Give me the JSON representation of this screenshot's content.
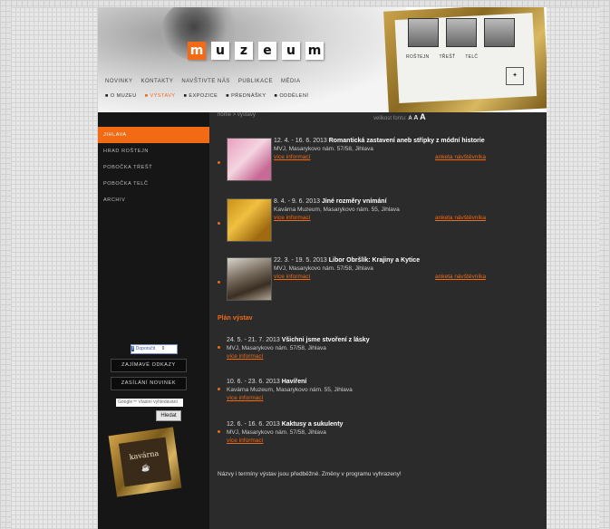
{
  "header": {
    "logo_letters": [
      "m",
      "u",
      "z",
      "e",
      "u",
      "m"
    ],
    "top_nav": [
      "NOVINKY",
      "KONTAKTY",
      "NAVŠTIVTE NÁS",
      "PUBLIKACE",
      "MÉDIA"
    ],
    "sub_nav": [
      "O MUZEU",
      "VÝSTAVY",
      "EXPOZICE",
      "PŘEDNÁŠKY",
      "ODDĚLENÍ"
    ],
    "active_sub": "VÝSTAVY",
    "branches": [
      "ROŠTEJN",
      "TŘEŠŤ",
      "TELČ"
    ],
    "accent": "#f26a13"
  },
  "sidebar": {
    "items": [
      "JIHLAVA",
      "HRAD ROŠTEJN",
      "POBOČKA TŘEŠŤ",
      "POBOČKA TELČ",
      "ARCHIV"
    ],
    "active": "JIHLAVA",
    "fb_label": "Doporučit",
    "fb_count": "9",
    "btn_links": "ZAJÍMAVÉ ODKAZY",
    "btn_news": "ZASÍLÁNÍ NOVINEK",
    "search_placeholder": "Google™ Vlastní vyhledávání",
    "search_button": "Hledat",
    "kavarna": "kavárna"
  },
  "content": {
    "breadcrumb": "home > výstavy",
    "font_size_label": "velikost fontu:",
    "font_size_letters": [
      "A",
      "A",
      "A"
    ],
    "exhibitions": [
      {
        "dates": "12. 4. - 16. 6. 2013",
        "title": "Romantická zastavení aneb střípky z módní historie",
        "place": "MVJ, Masarykovo nám. 57/58, Jihlava",
        "more": "více informací",
        "survey": "anketa návštěvníka"
      },
      {
        "dates": "8. 4. - 9. 6. 2013",
        "title": "Jiné rozměry vnímání",
        "place": "Kavárna Muzeum, Masarykovo nám. 55, Jihlava",
        "more": "více informací",
        "survey": "anketa návštěvníka"
      },
      {
        "dates": "22. 3. - 19. 5. 2013",
        "title": "Libor Obršlík: Krajiny a Kytice",
        "place": "MVJ, Masarykovo nám. 57/58, Jihlava",
        "more": "více informací",
        "survey": "anketa návštěvníka"
      }
    ],
    "plan_heading": "Plán výstav",
    "planned": [
      {
        "dates": "24. 5. - 21. 7. 2013",
        "title": "Všichni jsme stvoření z lásky",
        "place": "MVJ, Masarykovo nám. 57/58, Jihlava",
        "more": "více informací"
      },
      {
        "dates": "10. 6. - 23. 6. 2013",
        "title": "Havíření",
        "place": "Kavárna Muzeum, Masarykovo nám. 55, Jihlava",
        "more": "více informací"
      },
      {
        "dates": "12. 6. - 16. 6. 2013",
        "title": "Kaktusy a sukulenty",
        "place": "MVJ, Masarykovo nám. 57/58, Jihlava",
        "more": "více informací"
      }
    ],
    "note": "Názvy i termíny výstav jsou předběžné. Změny v programu vyhrazeny!"
  }
}
